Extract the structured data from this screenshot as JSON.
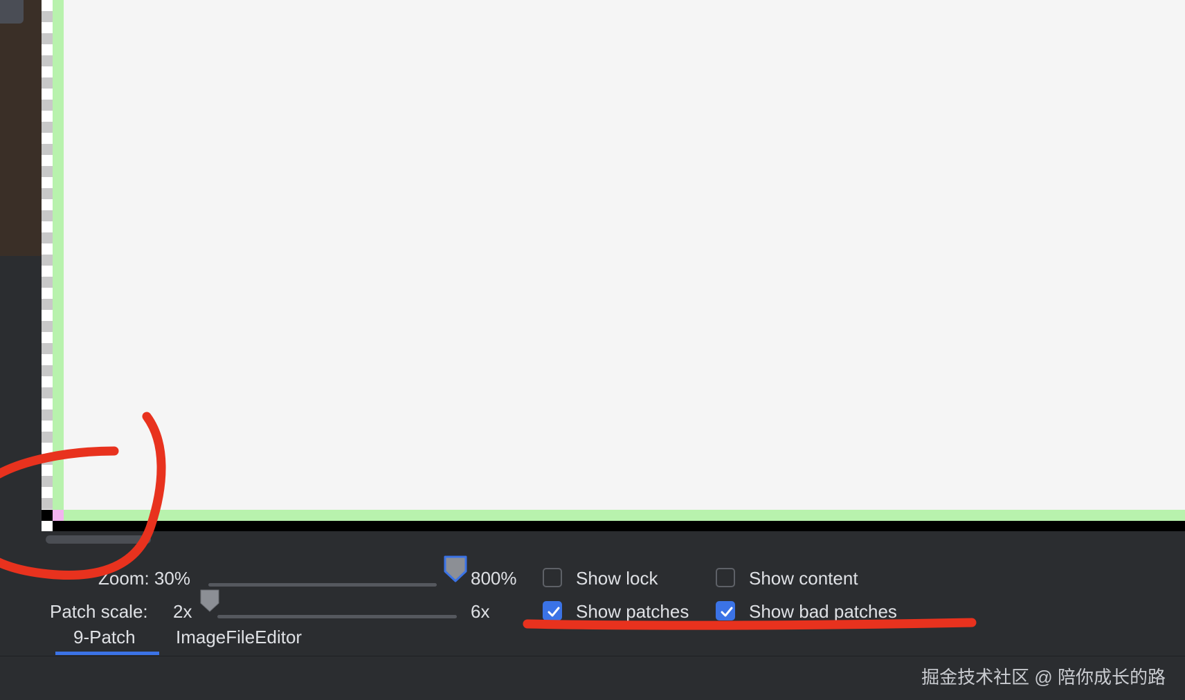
{
  "controls": {
    "zoom": {
      "label": "Zoom: 30%",
      "max_label": "800%",
      "value_percent": 30
    },
    "patch_scale": {
      "label": "Patch scale:",
      "min_label": "2x",
      "max_label": "6x",
      "value": 2
    },
    "checkboxes": {
      "show_lock": {
        "label": "Show lock",
        "checked": false
      },
      "show_content": {
        "label": "Show content",
        "checked": false
      },
      "show_patches": {
        "label": "Show patches",
        "checked": true
      },
      "show_bad_patches": {
        "label": "Show bad patches",
        "checked": true
      }
    }
  },
  "tabs": [
    {
      "label": "9-Patch",
      "active": true
    },
    {
      "label": "ImageFileEditor",
      "active": false
    }
  ],
  "watermark": "掘金技术社区 @ 陪你成长的路",
  "colors": {
    "accent": "#3b73e6",
    "patch_green": "#b8f2ad",
    "corner_pink": "#f2b3ef",
    "annotation_red": "#e8321e",
    "panel_bg": "#2b2d30"
  }
}
